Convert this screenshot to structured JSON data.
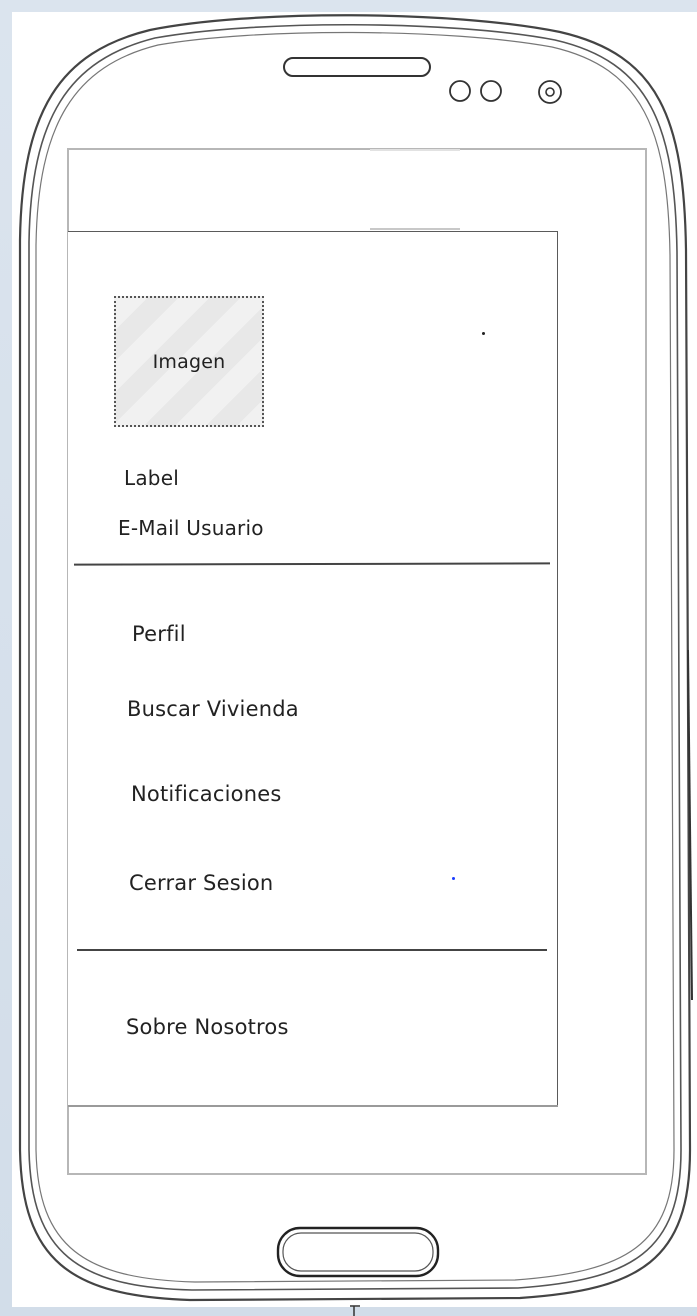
{
  "image_placeholder": {
    "label": "Imagen"
  },
  "user": {
    "name_label": "Label",
    "email_label": "E-Mail Usuario"
  },
  "menu": {
    "items": [
      {
        "label": "Perfil"
      },
      {
        "label": "Buscar Vivienda"
      },
      {
        "label": "Notificaciones"
      },
      {
        "label": "Cerrar Sesion"
      }
    ],
    "footer_items": [
      {
        "label": "Sobre Nosotros"
      }
    ]
  },
  "device": {
    "icons": [
      "speaker-slot-icon",
      "sensor-icon",
      "front-camera-icon",
      "home-button-icon"
    ]
  },
  "colors": {
    "background": "#d5e0ec",
    "screen_border": "#b7b7b7",
    "drawer_border": "#5a5a5a",
    "text": "#222222",
    "stray_dot": "#1a3cff"
  }
}
